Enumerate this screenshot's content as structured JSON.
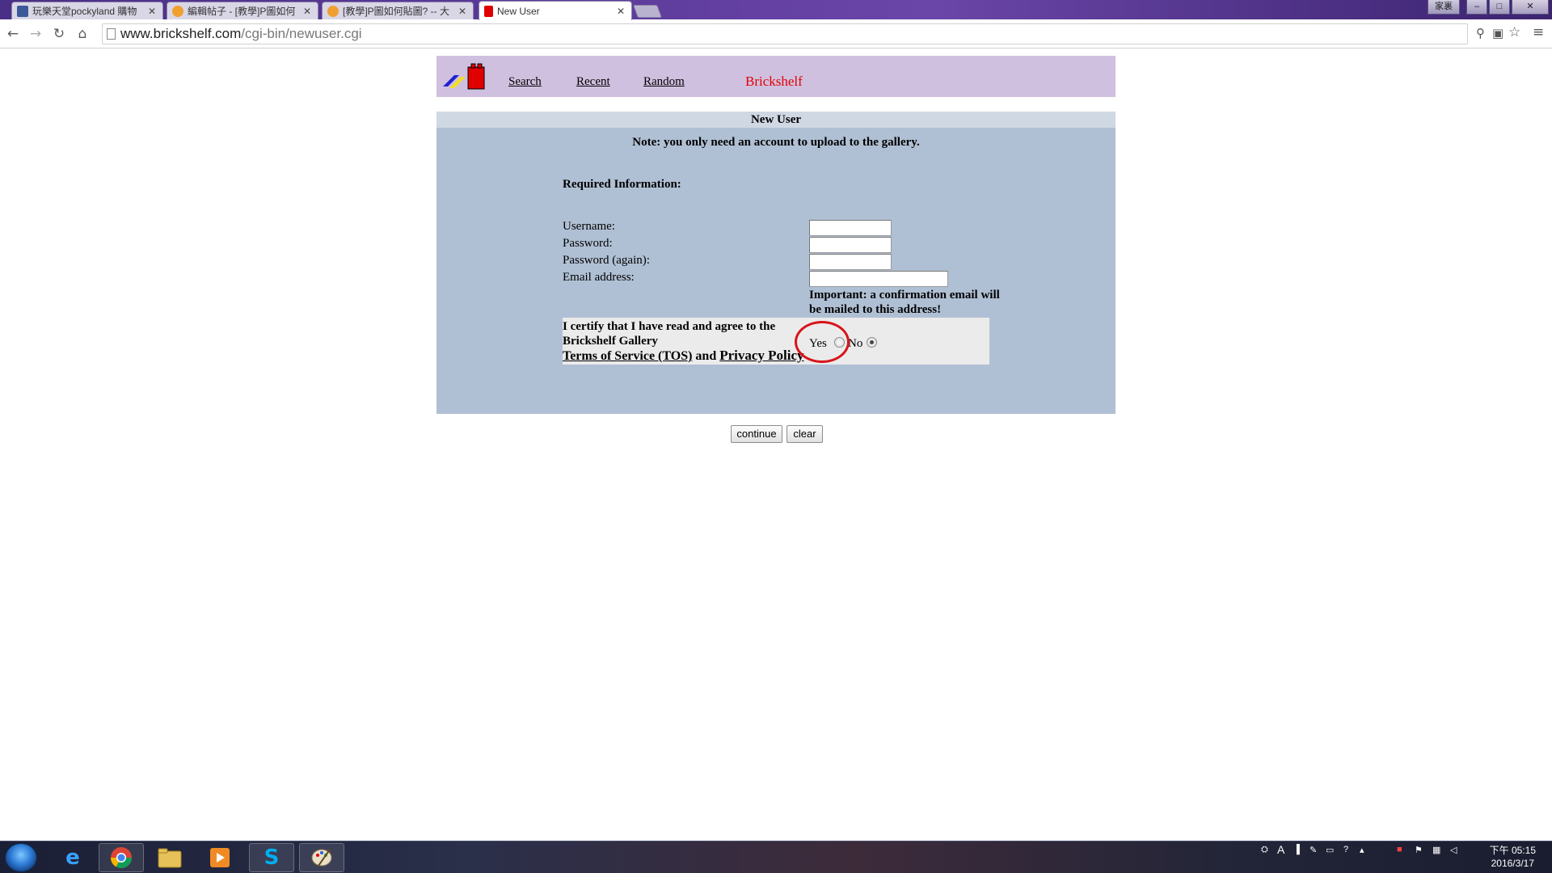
{
  "browser": {
    "tabs": [
      {
        "label": "玩樂天堂pockyland 購物",
        "favicon_color": "#3b5998"
      },
      {
        "label": "編輯帖子 - [教學]P圖如何",
        "favicon_color": "#f0a030"
      },
      {
        "label": "[教學]P圖如何貼圖? -- 大",
        "favicon_color": "#f0a030"
      },
      {
        "label": "New User",
        "favicon_color": "#e00000"
      }
    ],
    "window_user": "家裏",
    "url_domain": "www.brickshelf.com",
    "url_path": "/cgi-bin/newuser.cgi"
  },
  "site": {
    "nav": {
      "search": "Search",
      "recent": "Recent",
      "random": "Random",
      "brand": "Brickshelf"
    },
    "accent": "#d0c0e0",
    "brand_color": "#e00000"
  },
  "form": {
    "title": "New User",
    "note": "Note: you only need an account to upload to the gallery.",
    "required_heading": "Required Information:",
    "fields": {
      "username": {
        "label": "Username:",
        "value": ""
      },
      "password": {
        "label": "Password:",
        "value": ""
      },
      "password_again": {
        "label": "Password (again):",
        "value": ""
      },
      "email": {
        "label": "Email address:",
        "value": ""
      }
    },
    "important": "Important: a confirmation email will be mailed to this address!",
    "tos": {
      "line1": "I certify that I have read and agree to the",
      "line2": "Brickshelf Gallery",
      "tos_link": "Terms of Service (TOS)",
      "and": "and",
      "privacy_link": "Privacy Policy",
      "yes_label": "Yes",
      "no_label": "No",
      "selected": "No"
    },
    "buttons": {
      "continue": "continue",
      "clear": "clear"
    }
  },
  "taskbar": {
    "clock_time": "下午 05:15",
    "clock_date": "2016/3/17"
  }
}
